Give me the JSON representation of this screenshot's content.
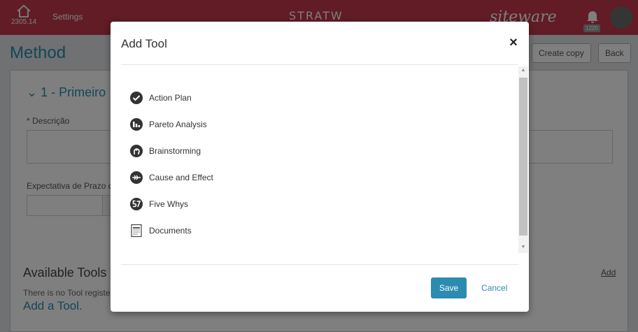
{
  "topbar": {
    "home_value": "2305.14",
    "settings_label": "Settings",
    "brand_center": "STRATW",
    "brand_right": "siteware",
    "notification_count": "1220"
  },
  "page": {
    "title": "Method",
    "create_copy_label": "Create copy",
    "back_label": "Back"
  },
  "section": {
    "title": "1 - Primeiro",
    "descricao_label": "* Descrição",
    "prazo_label": "Expectativa de Prazo d"
  },
  "available_tools": {
    "title": "Available Tools",
    "add_label": "Add",
    "empty_text": "There is no Tool registe",
    "add_tool_label": "Add a Tool."
  },
  "modal": {
    "title": "Add Tool",
    "close_symbol": "×",
    "tools": [
      {
        "label": "Action Plan",
        "icon": "check-circle-icon"
      },
      {
        "label": "Pareto Analysis",
        "icon": "bar-chart-icon"
      },
      {
        "label": "Brainstorming",
        "icon": "brain-head-icon"
      },
      {
        "label": "Cause and Effect",
        "icon": "fishbone-icon"
      },
      {
        "label": "Five Whys",
        "icon": "five-whys-icon"
      },
      {
        "label": "Documents",
        "icon": "document-icon"
      }
    ],
    "save_label": "Save",
    "cancel_label": "Cancel"
  },
  "colors": {
    "brand": "#c2394a",
    "accent": "#2b8bb0"
  }
}
